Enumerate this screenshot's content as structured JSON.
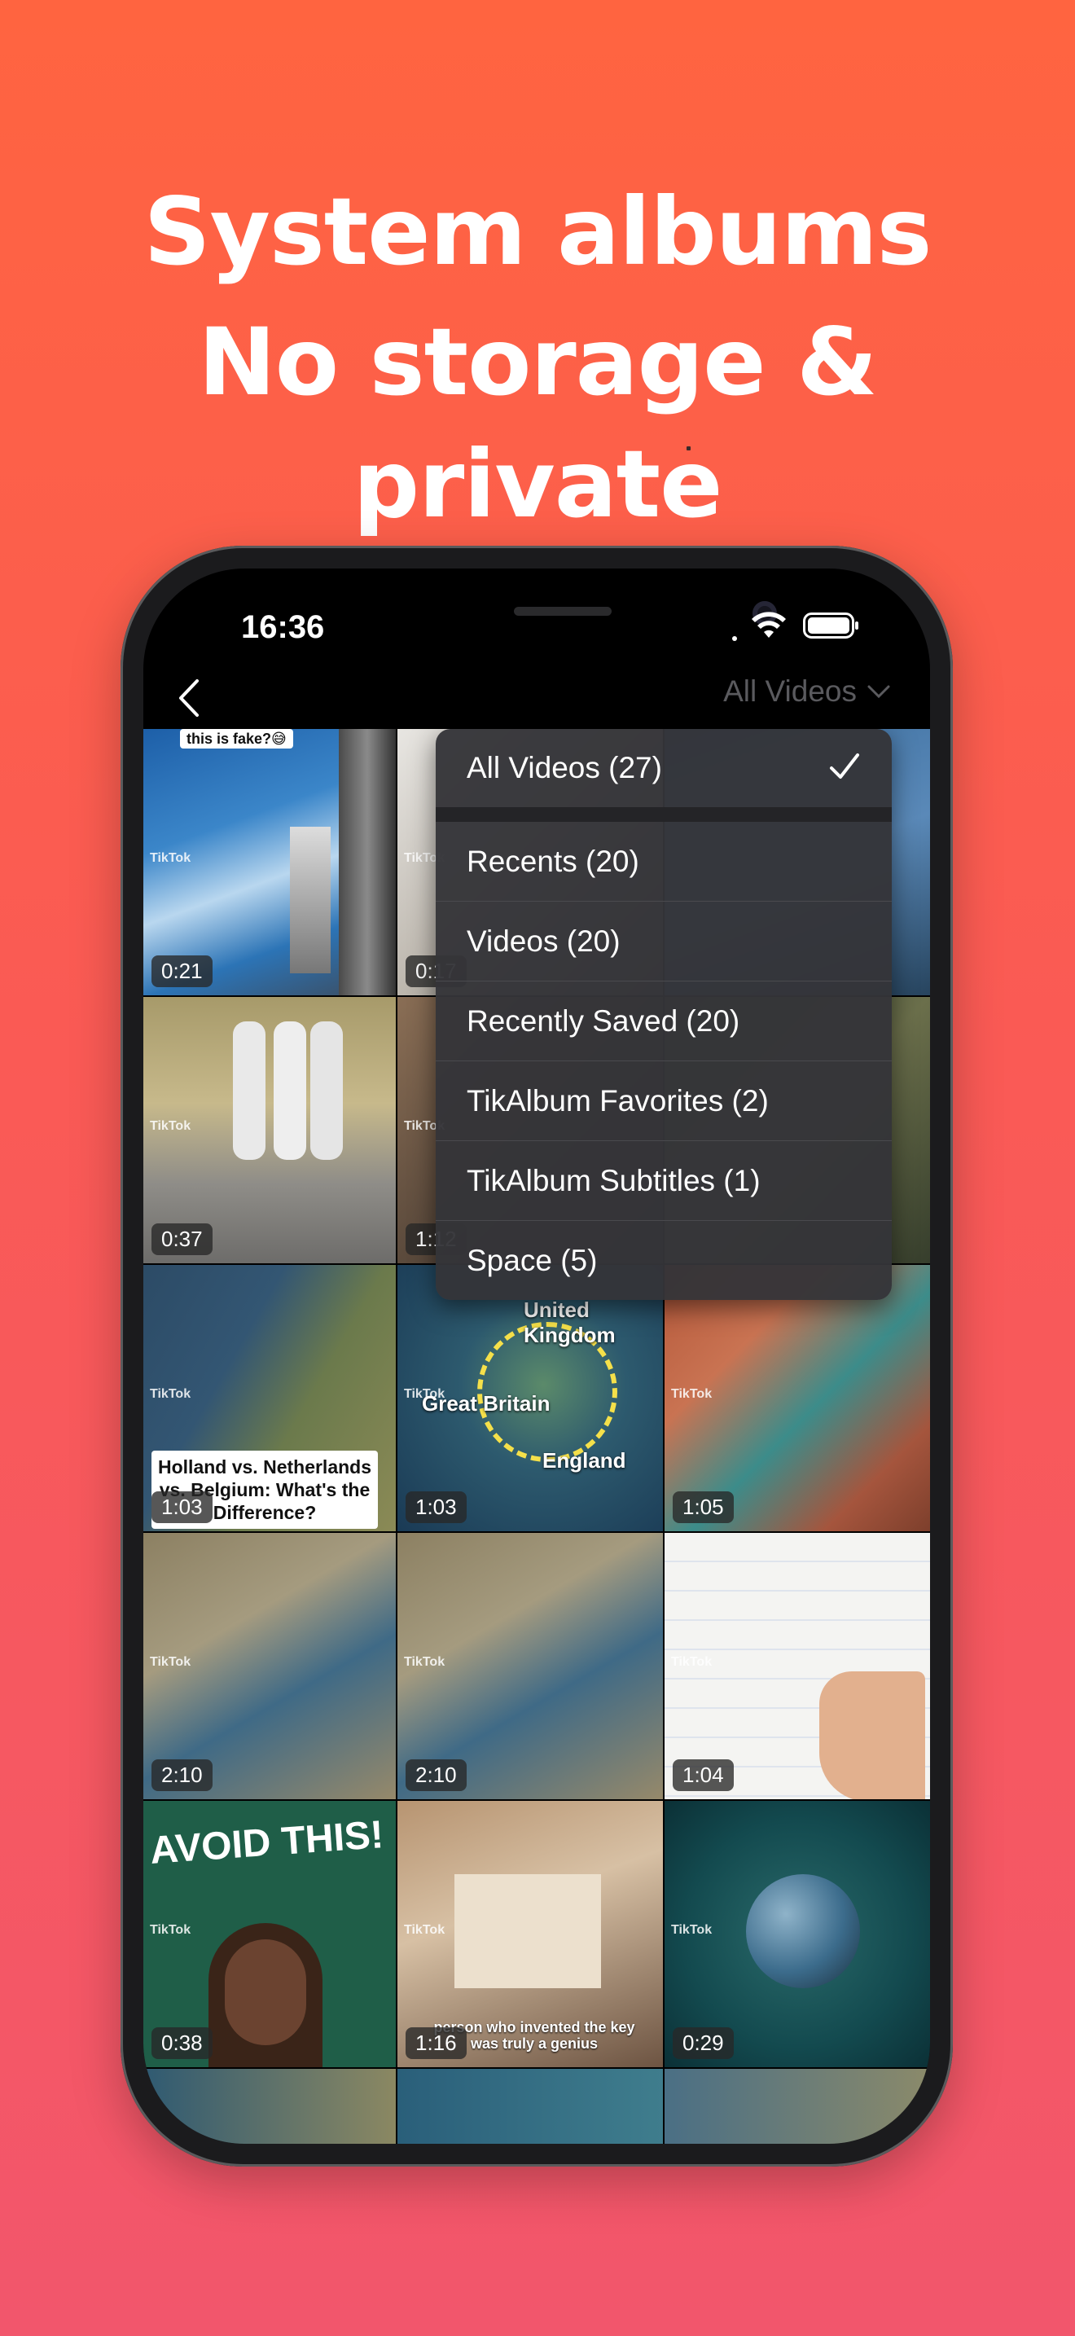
{
  "headline": {
    "line1": "System albums",
    "line2": "No storage & private"
  },
  "status_bar": {
    "time": "16:36"
  },
  "nav": {
    "title": "All Videos"
  },
  "menu": {
    "selected_index": 0,
    "items": [
      {
        "label": "All Videos (27)"
      },
      {
        "label": "Recents (20)"
      },
      {
        "label": "Videos (20)"
      },
      {
        "label": "Recently Saved (20)"
      },
      {
        "label": "TikAlbum Favorites (2)"
      },
      {
        "label": "TikAlbum Subtitles (1)"
      },
      {
        "label": "Space (5)"
      }
    ]
  },
  "videos": [
    {
      "duration": "0:21",
      "caption": "this is fake?😅"
    },
    {
      "duration": "0:17"
    },
    {
      "duration": "0:37"
    },
    {
      "duration": "1:12"
    },
    {
      "duration": "1:03",
      "caption": "Holland vs. Netherlands vs. Belgium: What's the Difference?"
    },
    {
      "duration": "1:03",
      "labels": [
        "United Kingdom",
        "Great Britain",
        "England"
      ]
    },
    {
      "duration": "1:05"
    },
    {
      "duration": "2:10"
    },
    {
      "duration": "2:10"
    },
    {
      "duration": "1:04"
    },
    {
      "duration": "0:38",
      "caption": "AVOID THIS!"
    },
    {
      "duration": "1:16",
      "caption": "person who invented the key was truly a genius"
    },
    {
      "duration": "0:29"
    }
  ],
  "colors": {
    "background_top": "#FF6440",
    "background_bottom": "#F2566C",
    "menu_bg": "#343438"
  }
}
